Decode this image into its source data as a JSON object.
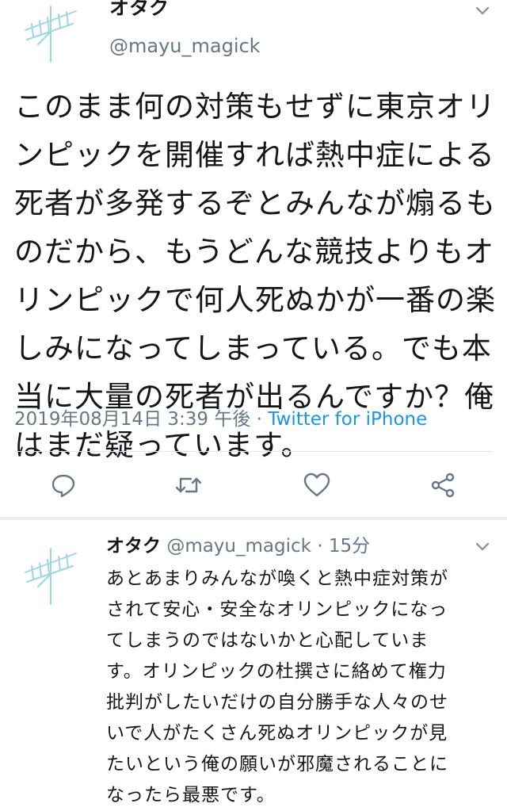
{
  "main_tweet": {
    "display_name": "オタク",
    "handle": "@mayu_magick",
    "lines": [
      "このまま何の対策もせずに東京オリ",
      "ンピックを開催すれば熱中症による",
      "死者が多発するぞとみんなが煽るも",
      "のだから、もうどんな競技よりもオ",
      "リンピックで何人死ぬかが一番の楽",
      "しみになってしまっている。でも本",
      "当に大量の死者が出るんですか？俺",
      "はまだ疑っています。"
    ],
    "timestamp": "2019年08月14日 3:39 午後",
    "separator": " · ",
    "source": "Twitter for iPhone"
  },
  "actions": {
    "reply_icon": "reply-icon",
    "retweet_icon": "retweet-icon",
    "like_icon": "heart-icon",
    "share_icon": "share-icon"
  },
  "reply_tweet": {
    "display_name": "オタク",
    "handle": "@mayu_magick",
    "dot": " · ",
    "time": "15分",
    "lines": [
      "あとあまりみんなが喚くと熱中症対策が",
      "されて安心・安全なオリンピックになっ",
      "てしまうのではないかと心配していま",
      "す。オリンピックの杜撰さに絡めて権力",
      "批判がしたいだけの自分勝手な人々のせ",
      "いで人がたくさん死ぬオリンピックが見",
      "たいという俺の願いが邪魔されることに",
      "なったら最悪です。"
    ]
  },
  "colors": {
    "text": "#14171a",
    "secondary": "#657786",
    "link": "#1b95e0",
    "divider": "#e1e8ed",
    "avatar_stroke": "#9fd6e6"
  }
}
